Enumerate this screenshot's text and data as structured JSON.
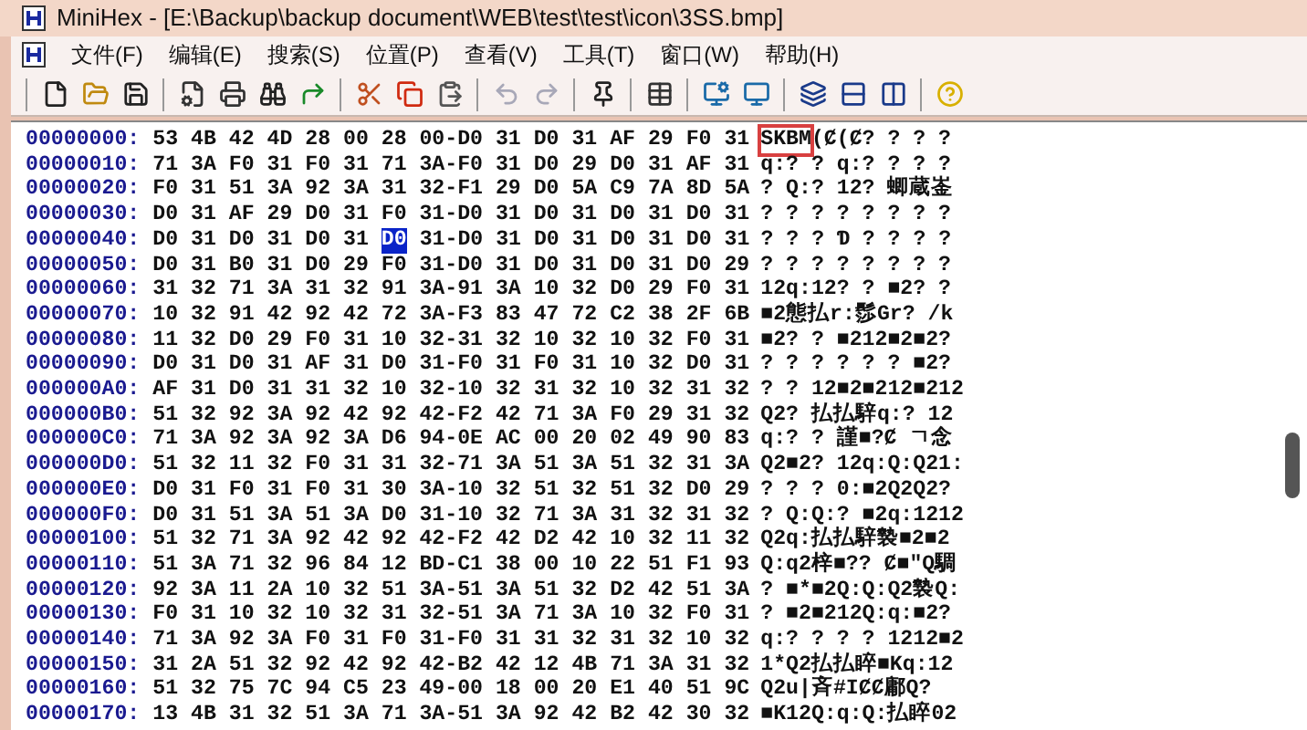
{
  "window": {
    "title": "MiniHex - [E:\\Backup\\backup document\\WEB\\test\\test\\icon\\3SS.bmp]"
  },
  "menu": [
    {
      "label": "文件(F)"
    },
    {
      "label": "编辑(E)"
    },
    {
      "label": "搜索(S)"
    },
    {
      "label": "位置(P)"
    },
    {
      "label": "查看(V)"
    },
    {
      "label": "工具(T)"
    },
    {
      "label": "窗口(W)"
    },
    {
      "label": "帮助(H)"
    }
  ],
  "toolbar": [
    {
      "items": [
        {
          "kind": "new",
          "disabled": false
        },
        {
          "kind": "open",
          "disabled": false
        },
        {
          "kind": "save",
          "disabled": false
        }
      ]
    },
    {
      "items": [
        {
          "kind": "properties",
          "disabled": false
        },
        {
          "kind": "print",
          "disabled": false
        },
        {
          "kind": "find",
          "disabled": false
        },
        {
          "kind": "goto",
          "disabled": false
        }
      ]
    },
    {
      "items": [
        {
          "kind": "cut",
          "disabled": false
        },
        {
          "kind": "copy",
          "disabled": false
        },
        {
          "kind": "paste",
          "disabled": false
        }
      ]
    },
    {
      "items": [
        {
          "kind": "undo",
          "disabled": true
        },
        {
          "kind": "redo",
          "disabled": true
        }
      ]
    },
    {
      "items": [
        {
          "kind": "pin",
          "disabled": false
        }
      ]
    },
    {
      "items": [
        {
          "kind": "table",
          "disabled": false
        }
      ]
    },
    {
      "items": [
        {
          "kind": "options",
          "disabled": false
        },
        {
          "kind": "display",
          "disabled": false
        }
      ]
    },
    {
      "items": [
        {
          "kind": "cascade",
          "disabled": false
        },
        {
          "kind": "split_horizontal",
          "disabled": false
        },
        {
          "kind": "split_vertical",
          "disabled": false
        }
      ]
    },
    {
      "items": [
        {
          "kind": "help",
          "disabled": false
        }
      ]
    }
  ],
  "hex_view": {
    "rows": [
      {
        "address": "00000000:",
        "hex": "53 4B 42 4D 28 00 28 00-D0 31 D0 31 AF 29 F0 31",
        "ascii_marked": "SKBM",
        "ascii": "(Ȼ(Ȼ? ? ? ?"
      },
      {
        "address": "00000010:",
        "hex": "71 3A F0 31 F0 31 71 3A-F0 31 D0 29 D0 31 AF 31",
        "ascii": "q:? ? q:? ? ? ?"
      },
      {
        "address": "00000020:",
        "hex": "F0 31 51 3A 92 3A 31 32-F1 29 D0 5A C9 7A 8D 5A",
        "ascii": "? Q:? 12? 蝍蔵崟"
      },
      {
        "address": "00000030:",
        "hex": "D0 31 AF 29 D0 31 F0 31-D0 31 D0 31 D0 31 D0 31",
        "ascii": "? ? ? ? ? ? ? ?"
      },
      {
        "address": "00000040:",
        "hex": "D0 31 D0 31 D0 31",
        "cursor": "D0",
        "hex_after": "31-D0 31 D0 31 D0 31 D0 31",
        "ascii": "? ? ? Ɗ ? ? ? ?"
      },
      {
        "address": "00000050:",
        "hex": "D0 31 B0 31 D0 29 F0 31-D0 31 D0 31 D0 31 D0 29",
        "ascii": "? ? ? ? ? ? ? ?"
      },
      {
        "address": "00000060:",
        "hex": "31 32 71 3A 31 32 91 3A-91 3A 10 32 D0 29 F0 31",
        "ascii": "12q:12? ? ■2? ?"
      },
      {
        "address": "00000070:",
        "hex": "10 32 91 42 92 42 72 3A-F3 83 47 72 C2 38 2F 6B",
        "ascii": "■2態払r:髿Gr? /k"
      },
      {
        "address": "00000080:",
        "hex": "11 32 D0 29 F0 31 10 32-31 32 10 32 10 32 F0 31",
        "ascii": "■2? ? ■212■2■2?"
      },
      {
        "address": "00000090:",
        "hex": "D0 31 D0 31 AF 31 D0 31-F0 31 F0 31 10 32 D0 31",
        "ascii": "? ? ? ? ? ? ■2?"
      },
      {
        "address": "000000A0:",
        "hex": "AF 31 D0 31 31 32 10 32-10 32 31 32 10 32 31 32",
        "ascii": "? ? 12■2■212■212"
      },
      {
        "address": "000000B0:",
        "hex": "51 32 92 3A 92 42 92 42-F2 42 71 3A F0 29 31 32",
        "ascii": "Q2? 払払騂q:? 12"
      },
      {
        "address": "000000C0:",
        "hex": "71 3A 92 3A 92 3A D6 94-0E AC 00 20 02 49 90 83",
        "ascii": "q:? ? 謹■?Ȼ ㄱ念"
      },
      {
        "address": "000000D0:",
        "hex": "51 32 11 32 F0 31 31 32-71 3A 51 3A 51 32 31 3A",
        "ascii": "Q2■2? 12q:Q:Q21:"
      },
      {
        "address": "000000E0:",
        "hex": "D0 31 F0 31 F0 31 30 3A-10 32 51 32 51 32 D0 29",
        "ascii": "? ? ? 0:■2Q2Q2?"
      },
      {
        "address": "000000F0:",
        "hex": "D0 31 51 3A 51 3A D0 31-10 32 71 3A 31 32 31 32",
        "ascii": "? Q:Q:? ■2q:1212"
      },
      {
        "address": "00000100:",
        "hex": "51 32 71 3A 92 42 92 42-F2 42 D2 42 10 32 11 32",
        "ascii": "Q2q:払払騂褺■2■2"
      },
      {
        "address": "00000110:",
        "hex": "51 3A 71 32 96 84 12 BD-C1 38 00 10 22 51 F1 93",
        "ascii": "Q:q2梓■?? Ȼ■\"Q騆"
      },
      {
        "address": "00000120:",
        "hex": "92 3A 11 2A 10 32 51 3A-51 3A 51 32 D2 42 51 3A",
        "ascii": "? ■*■2Q:Q:Q2褺Q:"
      },
      {
        "address": "00000130:",
        "hex": "F0 31 10 32 10 32 31 32-51 3A 71 3A 10 32 F0 31",
        "ascii": "? ■2■212Q:q:■2?"
      },
      {
        "address": "00000140:",
        "hex": "71 3A 92 3A F0 31 F0 31-F0 31 31 32 31 32 10 32",
        "ascii": "q:? ? ? ? 1212■2"
      },
      {
        "address": "00000150:",
        "hex": "31 2A 51 32 92 42 92 42-B2 42 12 4B 71 3A 31 32",
        "ascii": "1*Q2払払睟■Kq:12"
      },
      {
        "address": "00000160:",
        "hex": "51 32 75 7C 94 C5 23 49-00 18 00 20 E1 40 51 9C",
        "ascii": "Q2u|斉#IȻȻ鄘Q?"
      },
      {
        "address": "00000170:",
        "hex": "13 4B 31 32 51 3A 71 3A-51 3A 92 42 B2 42 30 32",
        "ascii": "■K12Q:q:Q:払睟02"
      }
    ]
  }
}
